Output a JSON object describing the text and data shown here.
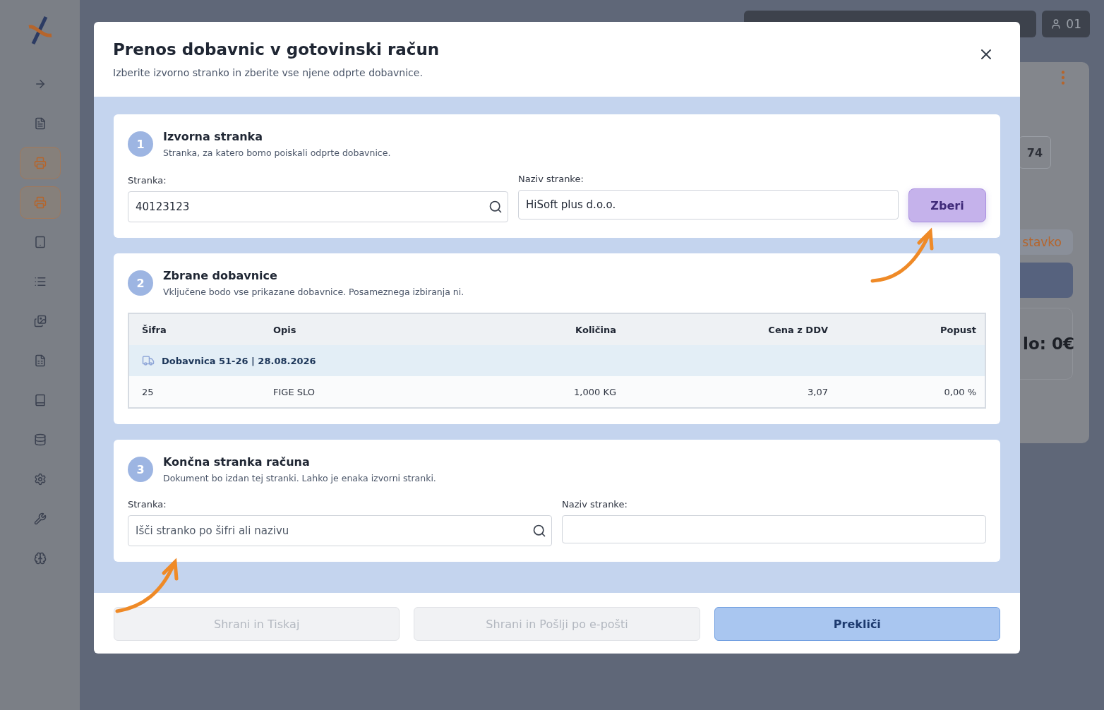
{
  "background": {
    "user": "01",
    "quantity": "74",
    "add_button": "stavko",
    "total": "lo: 0€",
    "sidebar": [
      {
        "selected": false
      },
      {
        "selected": false
      },
      {
        "selected": true
      },
      {
        "selected": true
      },
      {
        "selected": false
      },
      {
        "selected": false
      },
      {
        "selected": false
      },
      {
        "selected": false
      },
      {
        "selected": false
      },
      {
        "selected": false
      },
      {
        "selected": false
      },
      {
        "selected": false
      },
      {
        "selected": false
      }
    ]
  },
  "dialog": {
    "title": "Prenos dobavnic v gotovinski račun",
    "subtitle": "Izberite izvorno stranko in zberite vse njene odprte dobavnice.",
    "step1": {
      "number": "1",
      "title": "Izvorna stranka",
      "description": "Stranka, za katero bomo poiskali odprte dobavnice.",
      "customer_label": "Stranka:",
      "customer_value": "40123123",
      "name_label": "Naziv stranke:",
      "name_value": "HiSoft plus d.o.o.",
      "collect_button": "Zberi"
    },
    "step2": {
      "number": "2",
      "title": "Zbrane dobavnice",
      "description": "Vključene bodo vse prikazane dobavnice. Posameznega izbiranja ni.",
      "table": {
        "columns": [
          "Šifra",
          "Opis",
          "Količina",
          "Cena z DDV",
          "Popust"
        ],
        "rows": [
          {
            "kind": "group",
            "label": "Dobavnica 51-26 | 28.08.2026"
          },
          {
            "kind": "item",
            "cells": [
              "25",
              "FIGE SLO",
              "1,000 KG",
              "3,07",
              "0,00 %"
            ]
          }
        ]
      }
    },
    "step3": {
      "number": "3",
      "title": "Končna stranka računa",
      "description": "Dokument bo izdan tej stranki. Lahko je enaka izvorni stranki.",
      "customer_label": "Stranka:",
      "customer_placeholder": "Išči stranko po šifri ali nazivu",
      "name_label": "Naziv stranke:"
    },
    "buttons": [
      {
        "label": "Shrani in Tiskaj",
        "disabled": true
      },
      {
        "label": "Shrani in Pošlji po e-pošti",
        "disabled": true
      },
      {
        "label": "Prekliči",
        "disabled": false
      }
    ]
  }
}
